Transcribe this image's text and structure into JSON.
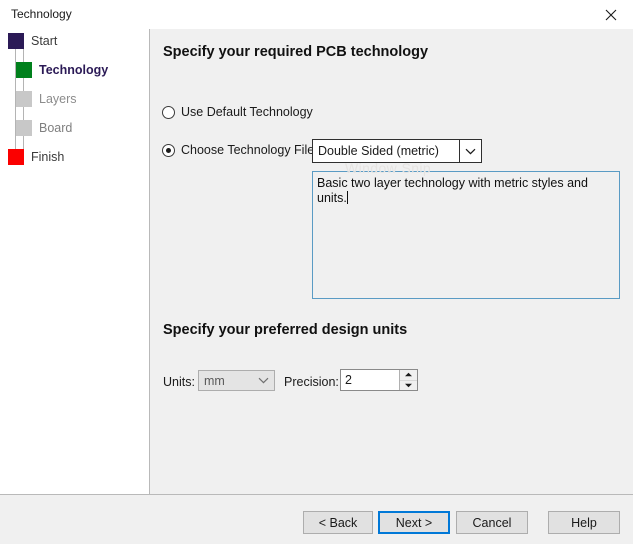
{
  "window": {
    "title": "Technology",
    "close_icon": "close-icon"
  },
  "sidebar": {
    "steps": [
      {
        "label": "Start",
        "color": "#2b1a56",
        "state": "done",
        "bold": false
      },
      {
        "label": "Technology",
        "color": "#00801c",
        "state": "current",
        "bold": true
      },
      {
        "label": "Layers",
        "color": "#c8c8c8",
        "state": "pending",
        "bold": false
      },
      {
        "label": "Board",
        "color": "#c8c8c8",
        "state": "pending",
        "bold": false
      },
      {
        "label": "Finish",
        "color": "#fb0000",
        "state": "pending",
        "bold": false
      }
    ]
  },
  "main": {
    "technology_heading": "Specify your required PCB technology",
    "radio_default": {
      "label": "Use Default Technology",
      "checked": false
    },
    "radio_choose": {
      "label": "Choose Technology File:",
      "checked": true
    },
    "technology_combo": {
      "value": "Double Sided (metric)",
      "arrow_icon": "chevron-down-icon"
    },
    "description": "Basic two layer technology with metric styles and units.",
    "units_heading": "Specify your preferred design units",
    "units_label": "Units:",
    "units_combo": {
      "value": "mm",
      "arrow_icon": "chevron-down-icon",
      "disabled": true
    },
    "precision_label": "Precision:",
    "precision_value": "2",
    "spinner_up_icon": "spinner-up-icon",
    "spinner_down_icon": "spinner-down-icon"
  },
  "footer": {
    "back": "< Back",
    "next": "Next >",
    "cancel": "Cancel",
    "help": "Help"
  },
  "artifacts": {
    "watermark": "Window Snip"
  },
  "colors": {
    "panel": "#f0f0f0",
    "accent": "#0078d7",
    "current_step_text": "#2b1a56",
    "pending_step_text": "#8c8c8c"
  }
}
